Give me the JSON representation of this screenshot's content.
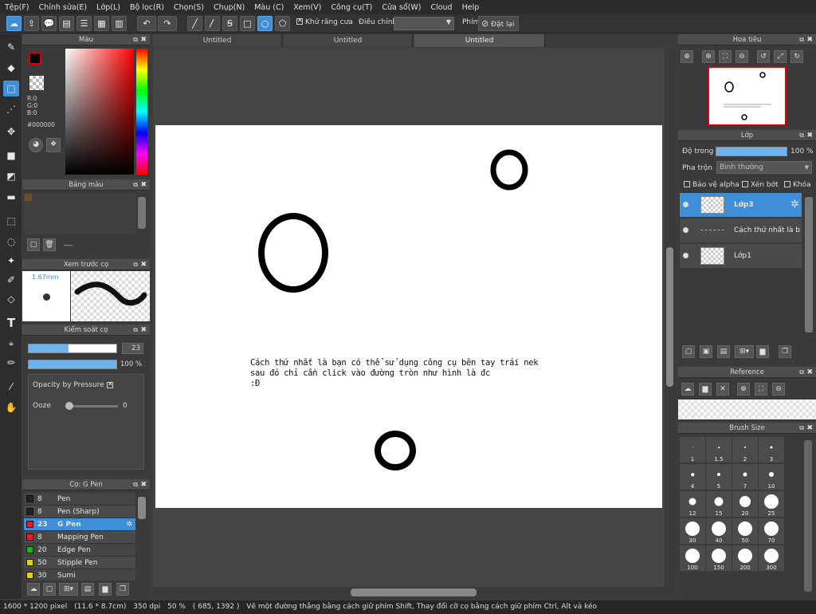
{
  "menu": [
    "Tệp(F)",
    "Chỉnh sửa(E)",
    "Lớp(L)",
    "Bộ lọc(R)",
    "Chọn(S)",
    "Chụp(N)",
    "Màu (C)",
    "Xem(V)",
    "Công cụ(T)",
    "Cửa sổ(W)",
    "Cloud",
    "Help"
  ],
  "toolbar": {
    "antialias_label": "Khử răng cưa",
    "adjust_label": "Điều chỉnh",
    "adjust_value": "",
    "keyboard_label": "Phím",
    "reset_label": "Đặt lại"
  },
  "tabs": [
    "Untitled",
    "Untitled",
    "Untitled"
  ],
  "color_panel": {
    "title": "Màu",
    "r": "R:0",
    "g": "G:0",
    "b": "B:0",
    "hex": "#000000",
    "fg_color": "#000000",
    "accent": "#3f8fd8"
  },
  "palette_panel": {
    "title": "Bảng màu",
    "swatch": "#7a4a1a",
    "dash": "----"
  },
  "brush_preview": {
    "title": "Xem trước cọ",
    "size": "1.67mm"
  },
  "brush_control": {
    "title": "Kiểm soát cọ",
    "size_value": "23",
    "size_fraction": 0.45,
    "opacity_value": "100 %",
    "opacity_fraction": 1.0,
    "opacity_pressure_label": "Opacity by Pressure",
    "ooze_label": "Ooze",
    "ooze_value": "0"
  },
  "brush_list": {
    "title": "Cọ: G Pen",
    "items": [
      {
        "size": "8",
        "name": "Pen",
        "color": "#222222",
        "selected": false
      },
      {
        "size": "8",
        "name": "Pen (Sharp)",
        "color": "#222222",
        "selected": false
      },
      {
        "size": "23",
        "name": "G Pen",
        "color": "#e02020",
        "selected": true
      },
      {
        "size": "8",
        "name": "Mapping Pen",
        "color": "#e02020",
        "selected": false
      },
      {
        "size": "20",
        "name": "Edge Pen",
        "color": "#20b020",
        "selected": false
      },
      {
        "size": "50",
        "name": "Stipple Pen",
        "color": "#e0d020",
        "selected": false
      },
      {
        "size": "30",
        "name": "Sumi",
        "color": "#e0d020",
        "selected": false
      }
    ]
  },
  "canvas": {
    "text_line1": "Cách thứ nhất là bạn có thể sử dụng công cụ bên tay trái nek",
    "text_line2": "sau đó chỉ cần click vào đường tròn như hình là đc",
    "text_line3": ":Đ"
  },
  "navigator": {
    "title": "Hoa tiêu"
  },
  "layers": {
    "title": "Lớp",
    "opacity_label": "Độ trong",
    "opacity_value": "100 %",
    "blend_label": "Pha trộn",
    "blend_value": "Bình thường",
    "protect_alpha": "Bảo vệ alpha",
    "clipping": "Xén bớt",
    "lock": "Khóa",
    "items": [
      {
        "name": "Lớp3",
        "selected": true
      },
      {
        "name": "Cách thứ nhất là b",
        "selected": false
      },
      {
        "name": "Lớp1",
        "selected": false
      }
    ]
  },
  "reference": {
    "title": "Reference"
  },
  "brush_size": {
    "title": "Brush Size",
    "sizes": [
      "1",
      "1.5",
      "2",
      "3",
      "4",
      "5",
      "7",
      "10",
      "12",
      "15",
      "20",
      "25",
      "30",
      "40",
      "50",
      "70",
      "100",
      "150",
      "200",
      "300"
    ]
  },
  "status": {
    "dims": "1600 * 1200 pixel",
    "cm": "(11.6 * 8.7cm)",
    "dpi": "350 dpi",
    "zoom": "50 %",
    "coords": "( 685, 1392 )",
    "hint": "Vẽ một đường thẳng bằng cách giữ phím Shift, Thay đổi cỡ cọ bằng cách giữ phím Ctrl, Alt và kéo"
  }
}
